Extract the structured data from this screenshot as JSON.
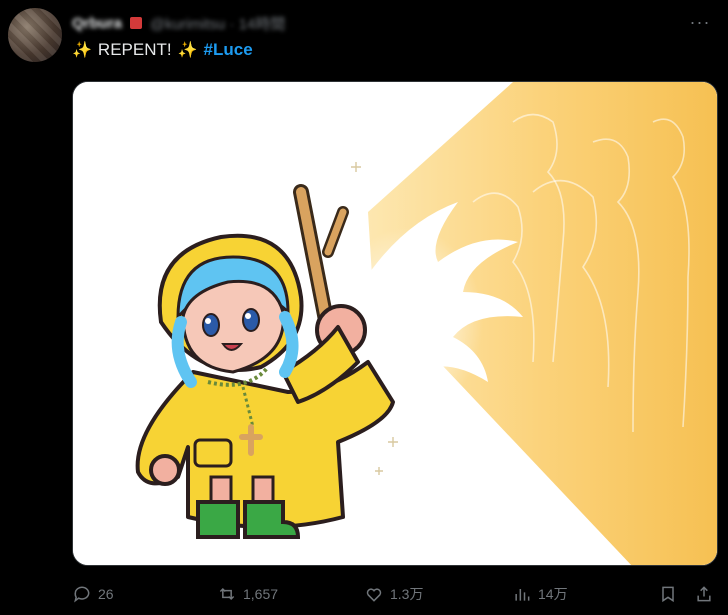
{
  "post": {
    "author_display_name": "Qrbura",
    "author_handle": "@kurimitsu · 14時間",
    "text_prefix_emoji": "✨",
    "text": "REPENT!",
    "text_suffix_emoji": "✨",
    "hashtag": "#Luce",
    "more_icon": "more-icon"
  },
  "actions": {
    "reply_count": "26",
    "retweet_count": "1,657",
    "like_count": "1.3万",
    "views_count": "14万"
  },
  "colors": {
    "background": "#000000",
    "text": "#e7e9ea",
    "secondary": "#71767b",
    "accent": "#1d9bf0"
  }
}
